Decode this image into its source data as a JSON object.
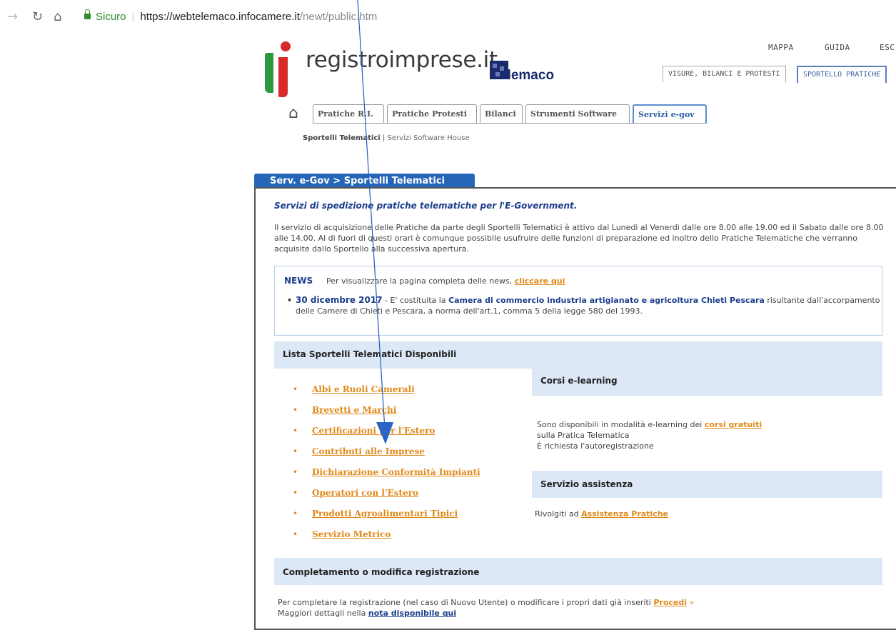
{
  "browser": {
    "secure_label": "Sicuro",
    "url_host": "https://webtelemaco.infocamere.it",
    "url_path": "/newt/public.htm"
  },
  "header": {
    "logo_text": "registroimprese.it",
    "telemaco_text": "elemaco",
    "links": [
      "MAPPA",
      "GUIDA",
      "ESC"
    ],
    "tabs": [
      "VISURE, BILANCI E PROTESTI",
      "SPORTELLO PRATICHE"
    ]
  },
  "nav": {
    "tabs": [
      "Pratiche R.I.",
      "Pratiche Protesti",
      "Bilanci",
      "Strumenti Software",
      "Servizi e-gov"
    ],
    "sub_active": "Sportelli Telematici",
    "sub_sep": "|",
    "sub_other": "Servizi Software House"
  },
  "panel": {
    "title": "Serv. e-Gov > Sportelli Telematici",
    "intro_title": "Servizi di spedizione pratiche telematiche per l'E-Government.",
    "intro_text": "Il servizio di acquisizione delle Pratiche da parte degli Sportelli Telematici è attivo dal Lunedì al Venerdì dalle ore 8.00 alle 19.00 ed il Sabato dalle ore 8.00 alle 14.00. Al di fuori di questi orari è comunque possibile usufruire delle funzioni di preparazione ed inoltro dello Pratiche Telematiche che verranno acquisite dallo Sportello alla successiva apertura."
  },
  "news": {
    "label": "NEWS",
    "intro": "Per visualizzare la pagina completa delle news,",
    "link": "cliccare qui",
    "item_date": "30 dicembre 2017",
    "item_dash": " - E' costituita la ",
    "item_bold": "Camera di commercio industria artigianato e agricoltura Chieti Pescara",
    "item_rest": " risultante dall'accorpamento delle Camere di Chieti e Pescara, a norma dell'art.1, comma 5 della legge 580 del 1993."
  },
  "sportelli": {
    "heading": "Lista Sportelli Telematici Disponibili",
    "items": [
      "Albi e Ruoli Camerali",
      "Brevetti e Marchi",
      "Certificazioni per l'Estero",
      "Contributi alle Imprese",
      "Dichiarazione Conformità Impianti",
      "Operatori con l'Estero",
      "Prodotti Agroalimentari Tipici",
      "Servizio Metrico"
    ]
  },
  "elearning": {
    "heading": "Corsi e-learning",
    "line1": "Sono disponibili in modalità e-learning dei",
    "link": "corsi gratuiti",
    "line2": "sulla Pratica Telematica",
    "line3": "È richiesta l'autoregistrazione"
  },
  "assistenza": {
    "heading": "Servizio assistenza",
    "text": "Rivolgiti ad",
    "link": "Assistenza Pratiche"
  },
  "registrazione": {
    "heading": "Completamento o modifica registrazione",
    "text": "Per completare la registrazione (nel caso di Nuovo Utente) o modificare i propri dati già inseriti",
    "link": "Procedi",
    "raquo": "»",
    "line2": "Maggiori dettagli nella",
    "link2": "nota disponibile qui"
  },
  "colors": {
    "accent_blue": "#2566b8",
    "link_orange": "#e08a1a",
    "section_bg": "#dce8f6",
    "annotation_arrow": "#1e5bbf"
  }
}
